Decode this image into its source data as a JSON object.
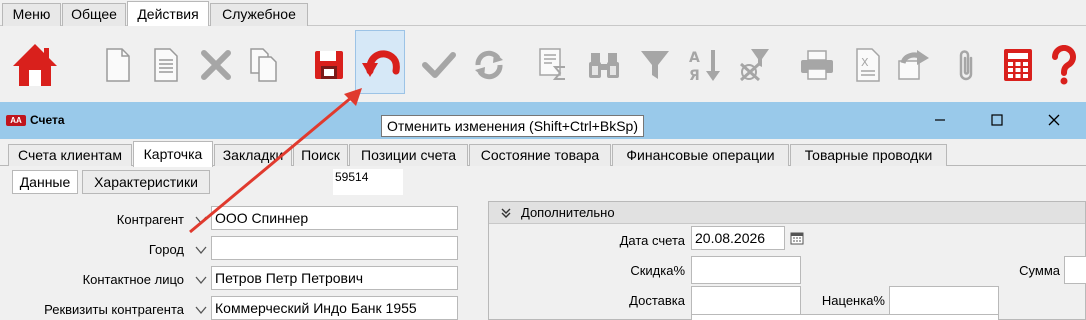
{
  "menubar": {
    "tabs": [
      {
        "label": "Меню"
      },
      {
        "label": "Общее"
      },
      {
        "label": "Действия"
      },
      {
        "label": "Служебное"
      }
    ],
    "active": "Действия"
  },
  "toolbar": {
    "buttons": [
      {
        "icon": "home-icon"
      },
      {
        "icon": "new-document-icon"
      },
      {
        "icon": "document-lines-icon"
      },
      {
        "icon": "delete-x-icon"
      },
      {
        "icon": "copy-icon"
      },
      {
        "icon": "save-icon"
      },
      {
        "icon": "undo-icon"
      },
      {
        "icon": "checkmark-icon"
      },
      {
        "icon": "refresh-icon"
      },
      {
        "icon": "sum-icon"
      },
      {
        "icon": "binoculars-icon"
      },
      {
        "icon": "filter-icon"
      },
      {
        "icon": "sort-icon"
      },
      {
        "icon": "clear-filter-icon"
      },
      {
        "icon": "print-icon"
      },
      {
        "icon": "excel-export-icon"
      },
      {
        "icon": "redo-arrow-icon"
      },
      {
        "icon": "paperclip-icon"
      },
      {
        "icon": "calculator-icon"
      },
      {
        "icon": "help-icon"
      }
    ],
    "colors": {
      "home": "#d9201c",
      "undo": "#d9201c",
      "calculator": "#d9201c",
      "help": "#d9201c",
      "disabled": "#b3b3b3"
    }
  },
  "window": {
    "title": "Счета",
    "logo_text": "AA",
    "title_bar_color": "#99c9ea"
  },
  "tooltip": "Отменить изменения (Shift+Ctrl+BkSp)",
  "tabs": [
    {
      "label": "Счета клиентам"
    },
    {
      "label": "Карточка"
    },
    {
      "label": "Закладки"
    },
    {
      "label": "Поиск"
    },
    {
      "label": "Позиции счета"
    },
    {
      "label": "Состояние товара"
    },
    {
      "label": "Финансовые операции"
    },
    {
      "label": "Товарные проводки"
    }
  ],
  "subtabs": [
    {
      "label": "Данные"
    },
    {
      "label": "Характеристики"
    }
  ],
  "doc_number": "59514",
  "form": {
    "contractor_label": "Контрагент",
    "contractor_value": "ООО Спиннер",
    "city_label": "Город",
    "city_value": "",
    "contact_label": "Контактное лицо",
    "contact_value": "Петров Петр Петрович",
    "requisites_label": "Реквизиты контрагента",
    "requisites_value": "Коммерческий Индо Банк 1955"
  },
  "extra": {
    "title": "Дополнительно",
    "date_label": "Дата счета",
    "date_value": "20.08.2026",
    "discount_label": "Скидка%",
    "discount_value": "",
    "delivery_label": "Доставка",
    "delivery_value": "",
    "markup_label": "Наценка%",
    "markup_value": "",
    "sum_label": "Сумма"
  }
}
